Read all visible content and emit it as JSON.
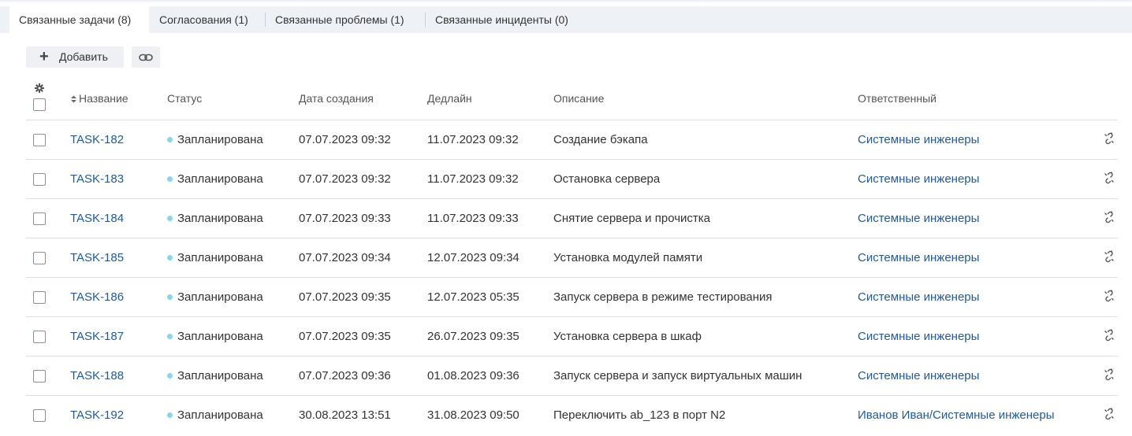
{
  "tabs": [
    {
      "label": "Связанные задачи (8)",
      "active": true
    },
    {
      "label": "Согласования (1)",
      "active": false
    },
    {
      "label": "Связанные проблемы (1)",
      "active": false
    },
    {
      "label": "Связанные инциденты (0)",
      "active": false
    }
  ],
  "toolbar": {
    "add_label": "Добавить",
    "add_icon": "plus-icon",
    "link_icon": "chain-link-icon"
  },
  "table": {
    "settings_icon": "gear-icon",
    "columns": {
      "name": "Название",
      "status": "Статус",
      "created": "Дата создания",
      "deadline": "Дедлайн",
      "description": "Описание",
      "owner": "Ответственный"
    },
    "status_dot_color": "#8fd3e8",
    "link_color": "#1f5b9b",
    "row_action_icon": "unlink-icon",
    "rows": [
      {
        "id": "TASK-182",
        "status": "Запланирована",
        "created": "07.07.2023 09:32",
        "deadline": "11.07.2023 09:32",
        "description": "Создание бэкапа",
        "owner": "Системные инженеры"
      },
      {
        "id": "TASK-183",
        "status": "Запланирована",
        "created": "07.07.2023 09:32",
        "deadline": "11.07.2023 09:32",
        "description": "Остановка сервера",
        "owner": "Системные инженеры"
      },
      {
        "id": "TASK-184",
        "status": "Запланирована",
        "created": "07.07.2023 09:33",
        "deadline": "11.07.2023 09:33",
        "description": "Снятие сервера и прочистка",
        "owner": "Системные инженеры"
      },
      {
        "id": "TASK-185",
        "status": "Запланирована",
        "created": "07.07.2023 09:34",
        "deadline": "12.07.2023 09:34",
        "description": "Установка модулей памяти",
        "owner": "Системные инженеры"
      },
      {
        "id": "TASK-186",
        "status": "Запланирована",
        "created": "07.07.2023 09:35",
        "deadline": "12.07.2023 05:35",
        "description": "Запуск сервера в режиме тестирования",
        "owner": "Системные инженеры"
      },
      {
        "id": "TASK-187",
        "status": "Запланирована",
        "created": "07.07.2023 09:35",
        "deadline": "26.07.2023 09:35",
        "description": "Установка сервера в шкаф",
        "owner": "Системные инженеры"
      },
      {
        "id": "TASK-188",
        "status": "Запланирована",
        "created": "07.07.2023 09:36",
        "deadline": "01.08.2023 09:36",
        "description": "Запуск сервера и запуск виртуальных машин",
        "owner": "Системные инженеры"
      },
      {
        "id": "TASK-192",
        "status": "Запланирована",
        "created": "30.08.2023 13:51",
        "deadline": "31.08.2023 09:50",
        "description": "Переключить ab_123 в порт N2",
        "owner": "Иванов Иван/Системные инженеры"
      }
    ]
  }
}
